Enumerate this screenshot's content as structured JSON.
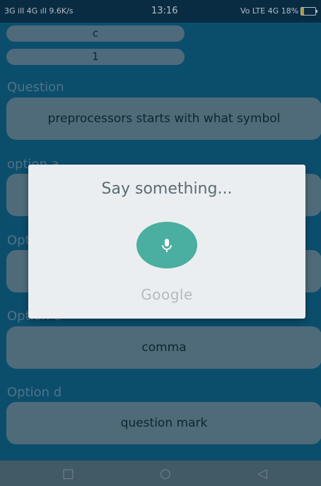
{
  "status_bar": {
    "left": "3G ill 4G ıll 9.6K/s",
    "time": "13:16",
    "right": "Vo LTE 4G 18%",
    "battery_level": 0.18
  },
  "form": {
    "field_top": "c",
    "field_answer": "1",
    "question_label": "Question",
    "question_value": "preprocessors starts with what symbol",
    "option_a_label": "option a",
    "option_b_label": "Opti",
    "option_c_label": "Option c",
    "option_c_value": "comma",
    "option_d_label": "Option d",
    "option_d_value": "question mark"
  },
  "dialog": {
    "title": "Say something...",
    "brand": "Google"
  },
  "nav": {
    "recent": "□",
    "home": "○",
    "back": "◁"
  },
  "icons": {
    "mic": "mic-icon"
  },
  "colors": {
    "background": "#0c5f80",
    "mic_button": "#4aaea0",
    "dialog": "#ebeef0",
    "battery": "#ffd21f"
  }
}
